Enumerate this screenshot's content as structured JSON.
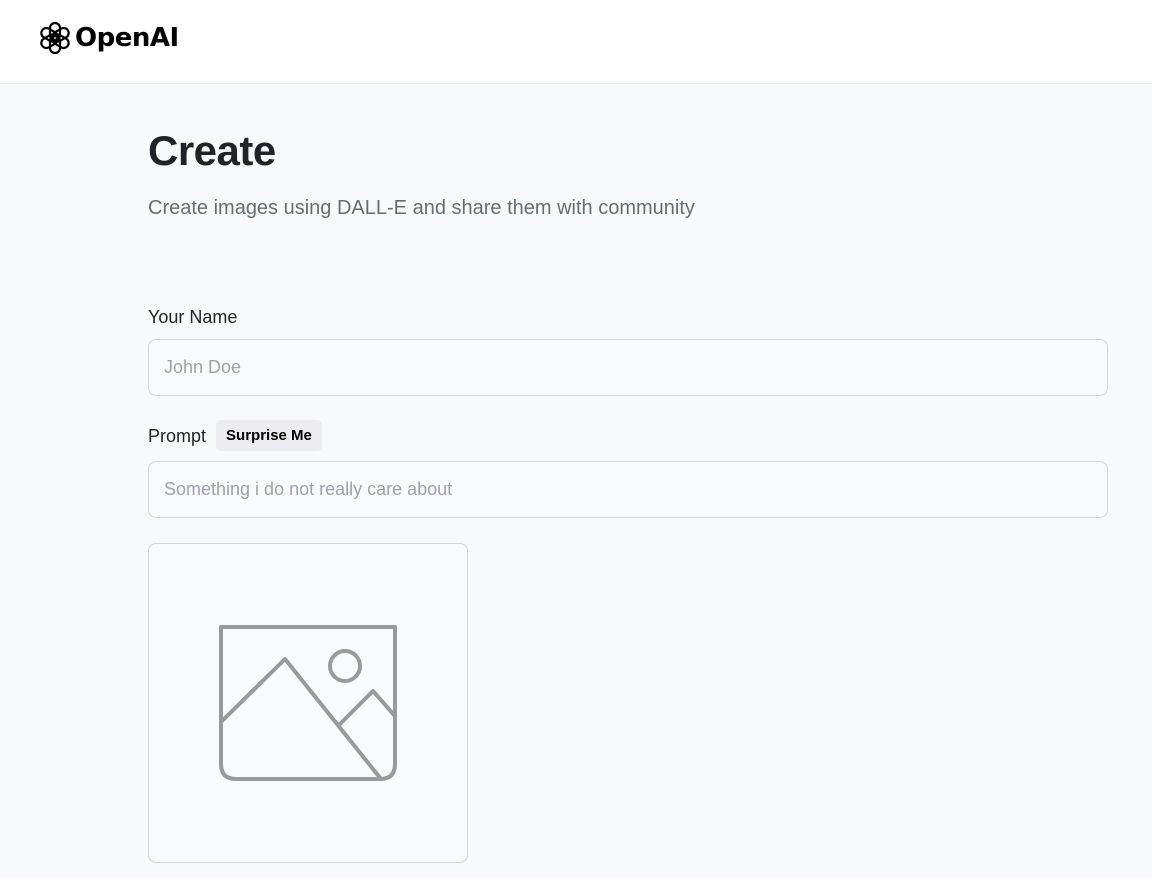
{
  "header": {
    "logo_text": "OpenAI",
    "logo_icon": "openai-logo-icon"
  },
  "main": {
    "title": "Create",
    "subtitle": "Create images using DALL-E and share them with community"
  },
  "form": {
    "name_label": "Your Name",
    "name_placeholder": "John Doe",
    "name_value": "",
    "prompt_label": "Prompt",
    "surprise_label": "Surprise Me",
    "prompt_placeholder": "Something i do not really care about",
    "prompt_value": ""
  },
  "preview": {
    "icon": "image-placeholder-icon"
  },
  "colors": {
    "background": "#f8f9fb",
    "header_bg": "#ffffff",
    "title": "#222328",
    "subtitle": "#666e75",
    "input_border": "#d1d5db",
    "placeholder_icon": "#9a9a9a",
    "button_bg": "#ececf1"
  }
}
